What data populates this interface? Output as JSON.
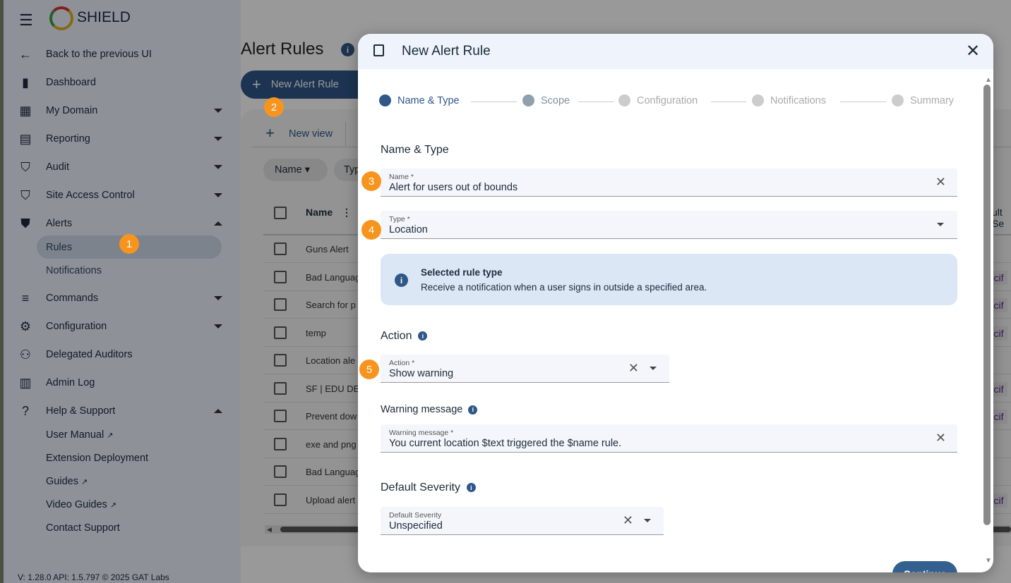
{
  "app": {
    "name": "SHIELD"
  },
  "sidebar": {
    "items": [
      {
        "label": "Back to the previous UI",
        "icon": "arrow-left-icon"
      },
      {
        "label": "Dashboard",
        "icon": "bar-chart-icon"
      },
      {
        "label": "My Domain",
        "icon": "building-icon"
      },
      {
        "label": "Reporting",
        "icon": "clipboard-icon"
      },
      {
        "label": "Audit",
        "icon": "audit-shield-icon"
      },
      {
        "label": "Site Access Control",
        "icon": "link-shield-icon"
      },
      {
        "label": "Alerts",
        "icon": "alert-shield-icon"
      },
      {
        "label": "Commands",
        "icon": "commands-icon"
      },
      {
        "label": "Configuration",
        "icon": "gear-icon"
      },
      {
        "label": "Delegated Auditors",
        "icon": "people-icon"
      },
      {
        "label": "Admin Log",
        "icon": "log-icon"
      },
      {
        "label": "Help & Support",
        "icon": "help-icon"
      }
    ],
    "alerts_sub": [
      "Rules",
      "Notifications"
    ],
    "help_sub": [
      "User Manual",
      "Extension Deployment",
      "Guides",
      "Video Guides",
      "Contact Support"
    ],
    "footer": "V: 1.28.0  API: 1.5.797  © 2025 GAT Labs"
  },
  "page": {
    "title": "Alert Rules",
    "new_rule": "New Alert Rule",
    "new_view": "New view",
    "filters": [
      "Name",
      "Typ"
    ],
    "columns": {
      "name": "Name",
      "severity": "ult Se"
    },
    "rows": [
      {
        "name": "Guns Alert",
        "sev": ""
      },
      {
        "name": "Bad Languag",
        "sev": "Unspecif"
      },
      {
        "name": "Search for p",
        "sev": "Unspecif"
      },
      {
        "name": "temp",
        "sev": "Unspecif"
      },
      {
        "name": "Location ale",
        "sev": ""
      },
      {
        "name": "SF | EDU DE",
        "sev": "Unspecif"
      },
      {
        "name": "Prevent dow",
        "sev": "Unspecif"
      },
      {
        "name": "exe and png",
        "sev": ""
      },
      {
        "name": "Bad Languag",
        "sev": ""
      },
      {
        "name": "Upload alert",
        "sev": "Unspecif"
      }
    ]
  },
  "badges": [
    "1",
    "2",
    "3",
    "4",
    "5"
  ],
  "modal": {
    "title": "New Alert Rule",
    "steps": [
      "Name & Type",
      "Scope",
      "Configuration",
      "Notifications",
      "Summary"
    ],
    "section": "Name & Type",
    "name": {
      "label": "Name *",
      "value": "Alert for users out of bounds"
    },
    "type": {
      "label": "Type *",
      "value": "Location"
    },
    "info": {
      "title": "Selected rule type",
      "text": "Receive a notification when a user signs in outside a specified area."
    },
    "action_heading": "Action",
    "action": {
      "label": "Action *",
      "value": "Show warning"
    },
    "warning_heading": "Warning message",
    "warning": {
      "label": "Warning message *",
      "value": "You current location $text triggered the $name rule."
    },
    "severity_heading": "Default Severity",
    "severity": {
      "label": "Default Severity",
      "value": "Unspecified"
    },
    "continue": "Continue"
  },
  "colors": {
    "accent": "#2f5788",
    "badge": "#f7941d"
  }
}
